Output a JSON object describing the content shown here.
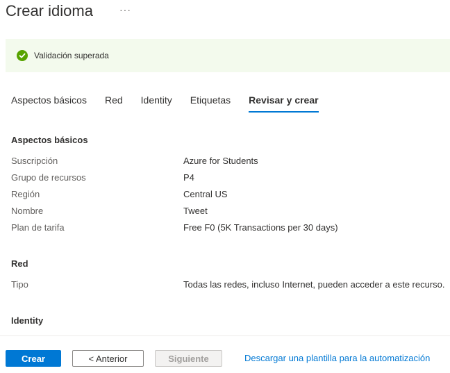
{
  "header": {
    "title": "Crear idioma",
    "more_label": "···"
  },
  "banner": {
    "text": "Validación superada",
    "icon": "check-circle-icon",
    "status_color": "#57a300"
  },
  "tabs": [
    {
      "label": "Aspectos básicos",
      "active": false
    },
    {
      "label": "Red",
      "active": false
    },
    {
      "label": "Identity",
      "active": false
    },
    {
      "label": "Etiquetas",
      "active": false
    },
    {
      "label": "Revisar y crear",
      "active": true
    }
  ],
  "sections": {
    "basics": {
      "title": "Aspectos básicos",
      "rows": [
        {
          "label": "Suscripción",
          "value": "Azure for Students"
        },
        {
          "label": "Grupo de recursos",
          "value": "P4"
        },
        {
          "label": "Región",
          "value": "Central US"
        },
        {
          "label": "Nombre",
          "value": "Tweet"
        },
        {
          "label": "Plan de tarifa",
          "value": "Free F0 (5K Transactions per 30 days)"
        }
      ]
    },
    "network": {
      "title": "Red",
      "rows": [
        {
          "label": "Tipo",
          "value": "Todas las redes, incluso Internet, pueden acceder a este recurso."
        }
      ]
    },
    "identity": {
      "title": "Identity"
    }
  },
  "footer": {
    "create_label": "Crear",
    "previous_label": "< Anterior",
    "next_label": "Siguiente",
    "download_link": "Descargar una plantilla para la automatización"
  },
  "colors": {
    "accent": "#0078d4",
    "success_bg": "#f3faed"
  }
}
